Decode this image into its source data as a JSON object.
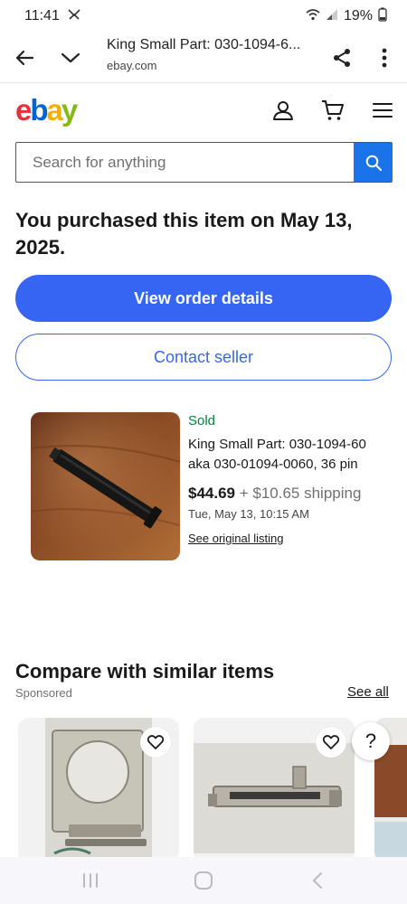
{
  "status_bar": {
    "time": "11:41",
    "battery": "19%"
  },
  "browser": {
    "tab_title": "King Small Part: 030-1094-6...",
    "domain": "ebay.com"
  },
  "header": {
    "logo": {
      "e": "e",
      "b": "b",
      "a": "a",
      "y": "y"
    }
  },
  "search": {
    "placeholder": "Search for anything"
  },
  "purchase": {
    "title": "You purchased this item on May 13, 2025.",
    "view_order_label": "View order details",
    "contact_seller_label": "Contact seller"
  },
  "item": {
    "status": "Sold",
    "name": "King Small Part: 030-1094-60 aka 030-01094-0060, 36 pin",
    "price": "$44.69",
    "shipping": "+ $10.65 shipping",
    "date": "Tue, May 13, 10:15 AM",
    "see_listing_label": "See original listing"
  },
  "compare": {
    "title": "Compare with similar items",
    "sponsored": "Sponsored",
    "see_all_label": "See all"
  },
  "help": {
    "label": "?"
  },
  "colors": {
    "primary_blue": "#3665f3",
    "search_blue": "#1a73e8",
    "sold_green": "#05823f",
    "logo_red": "#e53238",
    "logo_blue": "#0064d2",
    "logo_yellow": "#f5af02",
    "logo_green": "#86b817"
  }
}
